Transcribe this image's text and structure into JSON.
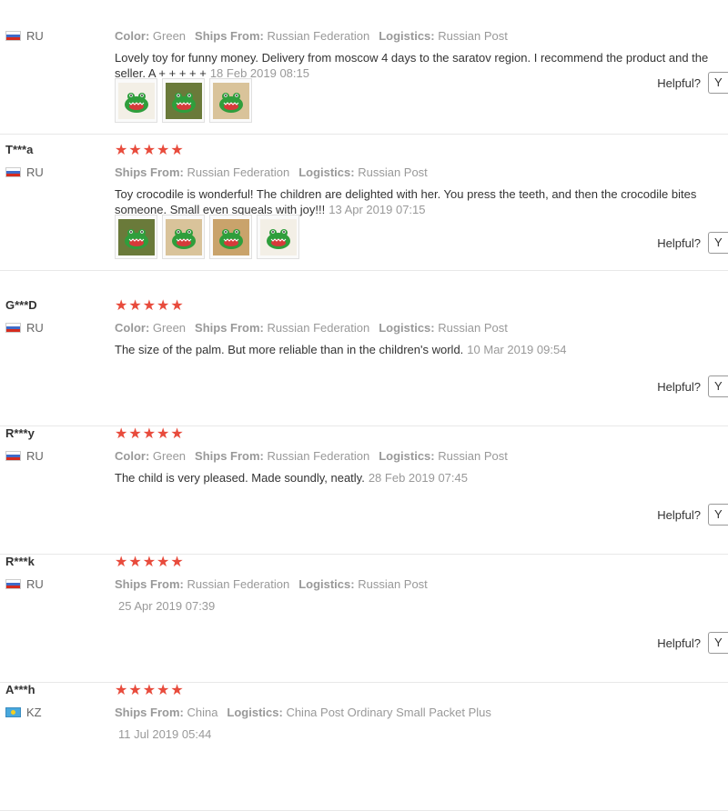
{
  "helpful_label": "Helpful?",
  "helpful_button_label": "Y",
  "stars_text": "★★★★★",
  "reviews": [
    {
      "user": "",
      "country": "RU",
      "attrs": [
        [
          "Color:",
          "Green"
        ],
        [
          "Ships From:",
          "Russian Federation"
        ],
        [
          "Logistics:",
          "Russian Post"
        ]
      ],
      "text": "Lovely toy for funny money. Delivery from moscow 4 days to the saratov region. I recommend the product and the seller. A + + + + +",
      "date": "18 Feb 2019 08:15",
      "photos": [
        "crocodile-photo",
        "crocodile-photo",
        "crocodile-photo"
      ]
    },
    {
      "user": "T***a",
      "country": "RU",
      "attrs": [
        [
          "Ships From:",
          "Russian Federation"
        ],
        [
          "Logistics:",
          "Russian Post"
        ]
      ],
      "text": "Toy crocodile is wonderful! The children are delighted with her. You press the teeth, and then the crocodile bites someone. Small even squeals with joy!!!",
      "date": "13 Apr 2019 07:15",
      "photos": [
        "crocodile-photo",
        "crocodile-photo",
        "crocodile-photo",
        "crocodile-photo"
      ]
    },
    {
      "user": "G***D",
      "country": "RU",
      "attrs": [
        [
          "Color:",
          "Green"
        ],
        [
          "Ships From:",
          "Russian Federation"
        ],
        [
          "Logistics:",
          "Russian Post"
        ]
      ],
      "text": "The size of the palm. But more reliable than in the children's world.",
      "date": "10 Mar 2019 09:54",
      "photos": []
    },
    {
      "user": "R***y",
      "country": "RU",
      "attrs": [
        [
          "Color:",
          "Green"
        ],
        [
          "Ships From:",
          "Russian Federation"
        ],
        [
          "Logistics:",
          "Russian Post"
        ]
      ],
      "text": "The child is very pleased. Made soundly, neatly.",
      "date": "28 Feb 2019 07:45",
      "photos": []
    },
    {
      "user": "R***k",
      "country": "RU",
      "attrs": [
        [
          "Ships From:",
          "Russian Federation"
        ],
        [
          "Logistics:",
          "Russian Post"
        ]
      ],
      "text": "",
      "date": "25 Apr 2019 07:39",
      "photos": []
    },
    {
      "user": "A***h",
      "country": "KZ",
      "attrs": [
        [
          "Ships From:",
          "China"
        ],
        [
          "Logistics:",
          "China Post Ordinary Small Packet Plus"
        ]
      ],
      "text": "",
      "date": "11 Jul 2019 05:44",
      "photos": []
    }
  ]
}
